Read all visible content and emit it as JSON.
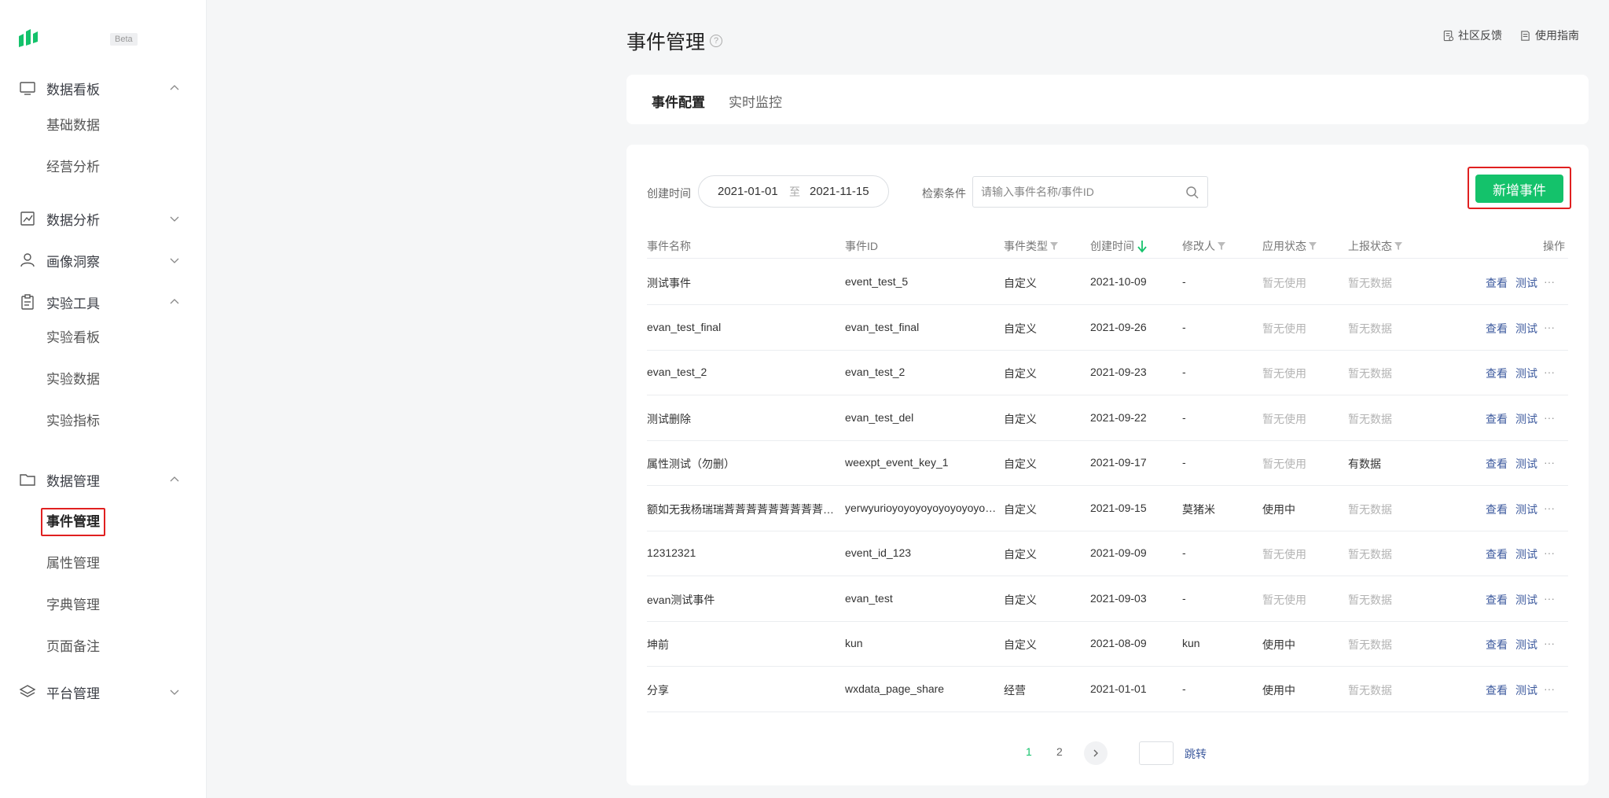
{
  "sidebar": {
    "beta_label": "Beta",
    "groups": [
      {
        "label": "数据看板",
        "icon": "monitor-icon",
        "expanded": true,
        "items": [
          "基础数据",
          "经营分析"
        ]
      },
      {
        "label": "数据分析",
        "icon": "line-chart-icon",
        "expanded": false,
        "items": []
      },
      {
        "label": "画像洞察",
        "icon": "user-portrait-icon",
        "expanded": false,
        "items": []
      },
      {
        "label": "实验工具",
        "icon": "clipboard-icon",
        "expanded": true,
        "items": [
          "实验看板",
          "实验数据",
          "实验指标"
        ]
      },
      {
        "label": "数据管理",
        "icon": "folder-icon",
        "expanded": true,
        "items": [
          "事件管理",
          "属性管理",
          "字典管理",
          "页面备注"
        ]
      },
      {
        "label": "平台管理",
        "icon": "layers-icon",
        "expanded": false,
        "items": []
      }
    ],
    "active_item": "事件管理"
  },
  "header": {
    "title": "事件管理",
    "help": "?",
    "links": [
      {
        "label": "社区反馈",
        "icon": "feedback-icon"
      },
      {
        "label": "使用指南",
        "icon": "guide-icon"
      }
    ]
  },
  "tabs": [
    {
      "label": "事件配置",
      "active": true
    },
    {
      "label": "实时监控",
      "active": false
    }
  ],
  "filters": {
    "date_label": "创建时间",
    "date_start": "2021-01-01",
    "date_sep": "至",
    "date_end": "2021-11-15",
    "search_label": "检索条件",
    "search_placeholder": "请输入事件名称/事件ID",
    "search_value": ""
  },
  "add_button": "新增事件",
  "columns": {
    "name": "事件名称",
    "id": "事件ID",
    "type": "事件类型",
    "created": "创建时间",
    "modifier": "修改人",
    "app_status": "应用状态",
    "report_status": "上报状态",
    "actions": "操作"
  },
  "row_actions": {
    "view": "查看",
    "test": "测试",
    "more": "···"
  },
  "rows": [
    {
      "name": "测试事件",
      "id": "event_test_5",
      "type": "自定义",
      "created": "2021-10-09",
      "modifier": "-",
      "app_status": "暂无使用",
      "report_status": "暂无数据",
      "app_active": false,
      "report_active": false
    },
    {
      "name": "evan_test_final",
      "id": "evan_test_final",
      "type": "自定义",
      "created": "2021-09-26",
      "modifier": "-",
      "app_status": "暂无使用",
      "report_status": "暂无数据",
      "app_active": false,
      "report_active": false
    },
    {
      "name": "evan_test_2",
      "id": "evan_test_2",
      "type": "自定义",
      "created": "2021-09-23",
      "modifier": "-",
      "app_status": "暂无使用",
      "report_status": "暂无数据",
      "app_active": false,
      "report_active": false
    },
    {
      "name": "测试删除",
      "id": "evan_test_del",
      "type": "自定义",
      "created": "2021-09-22",
      "modifier": "-",
      "app_status": "暂无使用",
      "report_status": "暂无数据",
      "app_active": false,
      "report_active": false
    },
    {
      "name": "属性测试（勿删）",
      "id": "weexpt_event_key_1",
      "type": "自定义",
      "created": "2021-09-17",
      "modifier": "-",
      "app_status": "暂无使用",
      "report_status": "有数据",
      "app_active": false,
      "report_active": true
    },
    {
      "name": "额如无我杨瑞瑞萕萕萕萕萕萕萕萕萕萕萕萕萕萕萕萕萕",
      "id": "yerwyurioyoyoyoyoyoyoyoyoyoyoyoyoyoy",
      "type": "自定义",
      "created": "2021-09-15",
      "modifier": "莫猪米",
      "app_status": "使用中",
      "report_status": "暂无数据",
      "app_active": true,
      "report_active": false
    },
    {
      "name": "12312321",
      "id": "event_id_123",
      "type": "自定义",
      "created": "2021-09-09",
      "modifier": "-",
      "app_status": "暂无使用",
      "report_status": "暂无数据",
      "app_active": false,
      "report_active": false
    },
    {
      "name": "evan测试事件",
      "id": "evan_test",
      "type": "自定义",
      "created": "2021-09-03",
      "modifier": "-",
      "app_status": "暂无使用",
      "report_status": "暂无数据",
      "app_active": false,
      "report_active": false
    },
    {
      "name": "坤前",
      "id": "kun",
      "type": "自定义",
      "created": "2021-08-09",
      "modifier": "kun",
      "app_status": "使用中",
      "report_status": "暂无数据",
      "app_active": true,
      "report_active": false
    },
    {
      "name": "分享",
      "id": "wxdata_page_share",
      "type": "经营",
      "created": "2021-01-01",
      "modifier": "-",
      "app_status": "使用中",
      "report_status": "暂无数据",
      "app_active": true,
      "report_active": false
    }
  ],
  "pagination": {
    "pages": [
      "1",
      "2"
    ],
    "current": "1",
    "jump_label": "跳转",
    "jump_value": ""
  },
  "colors": {
    "accent": "#14c26b",
    "link": "#3d5a9e",
    "highlight": "#e02020"
  }
}
